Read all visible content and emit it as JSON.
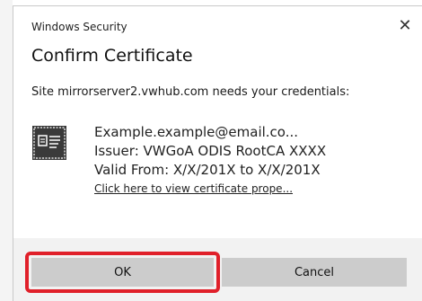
{
  "window": {
    "app_title": "Windows Security",
    "close_glyph": "✕",
    "heading": "Confirm Certificate",
    "message": "Site mirrorserver2.vwhub.com needs your credentials:"
  },
  "certificate": {
    "icon": "certificate-icon",
    "email": "Example.example@email.co...",
    "issuer": "Issuer: VWGoA ODIS RootCA XXXX",
    "valid_from": "Valid From: X/X/201X to X/X/201X",
    "link": "Click here to view certificate prope..."
  },
  "buttons": {
    "ok": "OK",
    "cancel": "Cancel"
  },
  "colors": {
    "highlight": "#e0202a",
    "button_bg": "#cccccc",
    "footer_bg": "#f2f2f2",
    "icon_dark": "#3a3a3a"
  }
}
